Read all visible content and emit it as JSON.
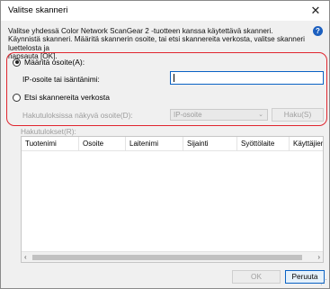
{
  "window": {
    "title": "Valitse skanneri",
    "close_glyph": "✕"
  },
  "intro": {
    "lines": [
      "Valitse yhdessä Color Network ScanGear 2 -tuotteen kanssa käytettävä skanneri.",
      "Käynnistä skanneri. Määritä skannerin osoite, tai etsi skannereita verkosta, valitse skanneri luettelosta ja",
      "napsauta [OK]."
    ],
    "help_glyph": "?"
  },
  "specify": {
    "radio_label": "Määritä osoite(A):",
    "ip_label": "IP-osoite tai isäntänimi:",
    "ip_value": ""
  },
  "search": {
    "radio_label": "Etsi skannereita verkosta",
    "display_label": "Hakutuloksissa näkyvä osoite(D):",
    "select_value": "IP-osoite",
    "search_button": "Haku(S)"
  },
  "results": {
    "label": "Hakutulokset(R):",
    "columns": [
      "Tuotenimi",
      "Osoite",
      "Laitenimi",
      "Sijainti",
      "Syöttölaite",
      "Käyttäjien"
    ],
    "rows": []
  },
  "footer": {
    "ok": "OK",
    "cancel": "Peruuta"
  },
  "colors": {
    "highlight_border": "#e0262f",
    "focus_border": "#0a62c4"
  }
}
